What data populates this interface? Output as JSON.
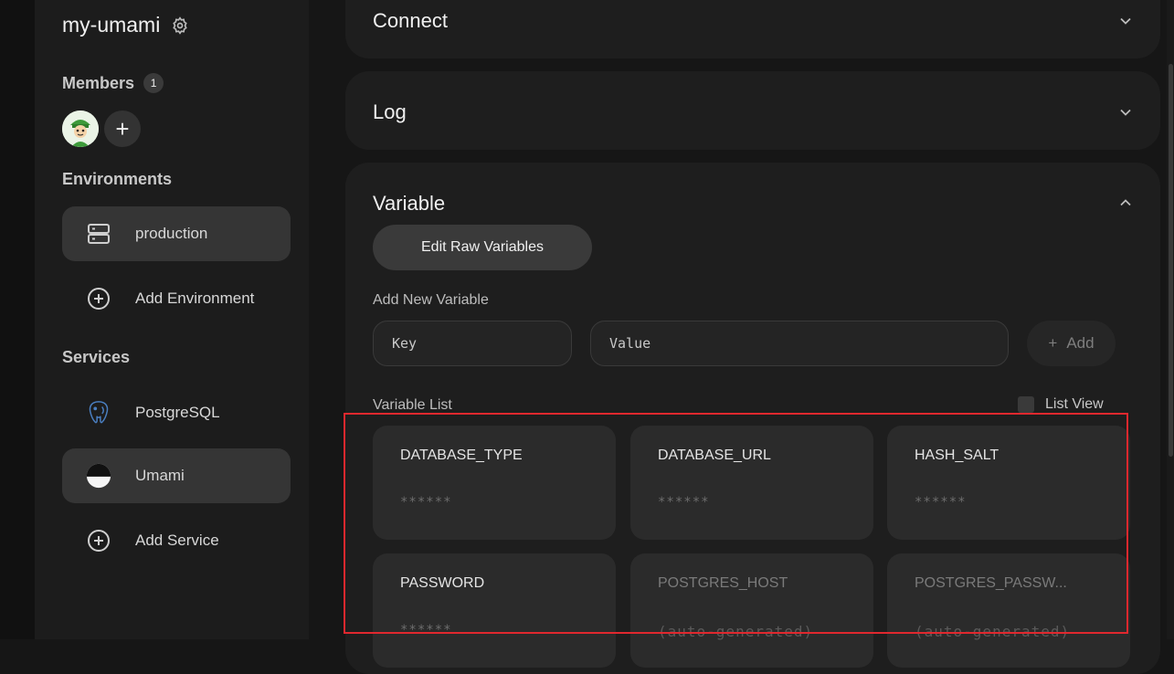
{
  "project": {
    "name": "my-umami"
  },
  "members": {
    "label": "Members",
    "count": "1",
    "add_symbol": "+"
  },
  "environments": {
    "label": "Environments",
    "items": [
      {
        "label": "production",
        "icon": "server-icon"
      }
    ],
    "add_label": "Add Environment"
  },
  "services": {
    "label": "Services",
    "items": [
      {
        "label": "PostgreSQL",
        "icon": "postgresql-icon"
      },
      {
        "label": "Umami",
        "icon": "umami-icon"
      }
    ],
    "add_label": "Add Service"
  },
  "sections": {
    "connect": "Connect",
    "log": "Log",
    "variable": "Variable"
  },
  "variable": {
    "edit_raw_label": "Edit Raw Variables",
    "add_new_label": "Add New Variable",
    "key_placeholder": "Key",
    "value_placeholder": "Value",
    "add_button_label": "Add",
    "add_button_symbol": "+",
    "list_label": "Variable List",
    "list_view_label": "List View",
    "items": [
      {
        "key": "DATABASE_TYPE",
        "value": "******"
      },
      {
        "key": "DATABASE_URL",
        "value": "******"
      },
      {
        "key": "HASH_SALT",
        "value": "******"
      },
      {
        "key": "PASSWORD",
        "value": "******"
      },
      {
        "key": "POSTGRES_HOST",
        "value": "(auto-generated)"
      },
      {
        "key": "POSTGRES_PASSW...",
        "value": "(auto-generated)"
      }
    ]
  },
  "colors": {
    "highlight": "#e0282e",
    "active_item": "#353535",
    "card": "#1e1e1e",
    "sidebar": "#1c1c1c"
  }
}
